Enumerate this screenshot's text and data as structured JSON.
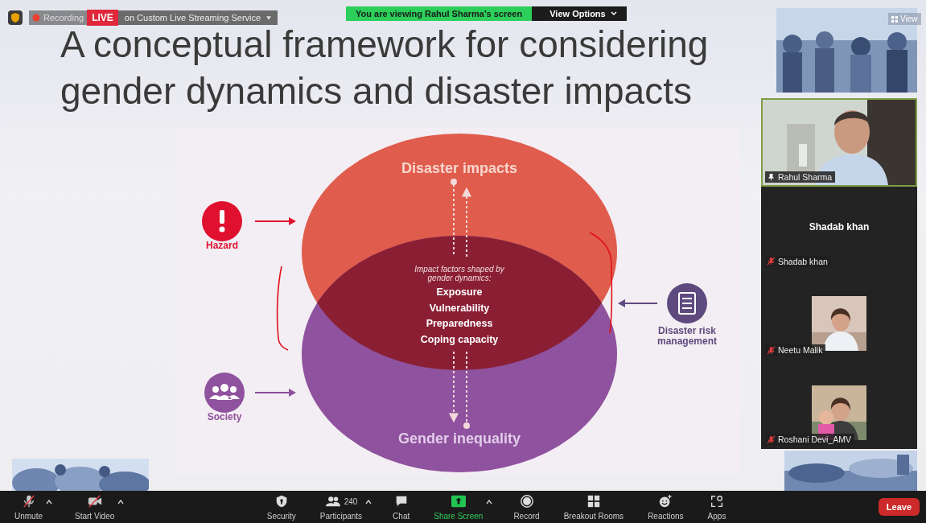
{
  "top_bar": {
    "recording_label": "Recording",
    "live_badge": "LIVE",
    "stream_label": "on Custom Live Streaming Service"
  },
  "share_banner": {
    "text": "You are viewing Rahul Sharma's screen",
    "button": "View Options"
  },
  "view_button": "View",
  "slide": {
    "title_lines": [
      "A conceptual framework for considering",
      "gender dynamics and disaster impacts"
    ],
    "diagram": {
      "top_label": "Disaster impacts",
      "bottom_label": "Gender inequality",
      "caption_lines": [
        "Impact factors shaped by",
        "gender dynamics:"
      ],
      "factors": [
        "Exposure",
        "Vulnerability",
        "Preparedness",
        "Coping capacity"
      ],
      "left_items": [
        {
          "label": "Hazard",
          "kind": "hazard"
        },
        {
          "label": "Society",
          "kind": "society"
        }
      ],
      "right_item": {
        "label_lines": [
          "Disaster risk",
          "management"
        ]
      }
    }
  },
  "gallery": [
    {
      "name": "Rahul Sharma",
      "kind": "video",
      "muted": false,
      "pinned": true,
      "active_speaker": true
    },
    {
      "name": "Shadab khan",
      "display_name": "Shadab khan",
      "kind": "name_only",
      "muted": true,
      "pinned": false,
      "active_speaker": false
    },
    {
      "name": "Neetu Malik",
      "muted": true,
      "pinned": false,
      "active_speaker": false
    },
    {
      "name": "Roshani Devi_AMV",
      "muted": true,
      "pinned": false,
      "active_speaker": false
    }
  ],
  "toolbar": [
    {
      "label": "Unmute",
      "kind": "mic_off",
      "has_menu": true
    },
    {
      "label": "Start Video",
      "kind": "video_off",
      "has_menu": true
    },
    {
      "label": "Security",
      "kind": "security",
      "has_menu": false
    },
    {
      "label": "Participants",
      "kind": "participants",
      "count": "240",
      "has_menu": true
    },
    {
      "label": "Chat",
      "kind": "chat",
      "has_menu": false
    },
    {
      "label": "Share Screen",
      "kind": "share",
      "has_menu": true
    },
    {
      "label": "Record",
      "kind": "record",
      "has_menu": false
    },
    {
      "label": "Breakout Rooms",
      "kind": "breakout",
      "has_menu": false
    },
    {
      "label": "Reactions",
      "kind": "reactions",
      "has_menu": false
    },
    {
      "label": "Apps",
      "kind": "apps",
      "has_menu": false
    }
  ],
  "leave_button": "Leave"
}
